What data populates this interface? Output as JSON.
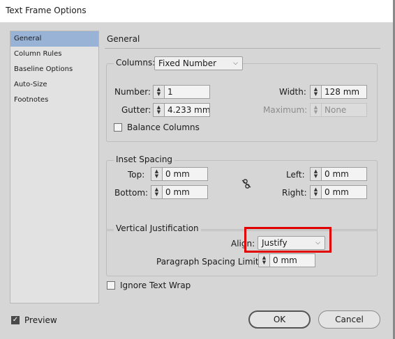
{
  "window": {
    "title": "Text Frame Options"
  },
  "sidebar": {
    "items": [
      {
        "label": "General",
        "selected": true
      },
      {
        "label": "Column Rules",
        "selected": false
      },
      {
        "label": "Baseline Options",
        "selected": false
      },
      {
        "label": "Auto-Size",
        "selected": false
      },
      {
        "label": "Footnotes",
        "selected": false
      }
    ]
  },
  "main": {
    "section_title": "General",
    "columns": {
      "label": "Columns:",
      "type_value": "Fixed Number",
      "number_label": "Number:",
      "number_value": "1",
      "gutter_label": "Gutter:",
      "gutter_value": "4.233 mm",
      "width_label": "Width:",
      "width_value": "128 mm",
      "maximum_label": "Maximum:",
      "maximum_value": "None",
      "balance_label": "Balance Columns",
      "balance_checked": false
    },
    "inset": {
      "legend": "Inset Spacing",
      "top_label": "Top:",
      "top_value": "0 mm",
      "bottom_label": "Bottom:",
      "bottom_value": "0 mm",
      "left_label": "Left:",
      "left_value": "0 mm",
      "right_label": "Right:",
      "right_value": "0 mm"
    },
    "vertical": {
      "legend": "Vertical Justification",
      "align_label": "Align:",
      "align_value": "Justify",
      "spacing_label": "Paragraph Spacing Limit:",
      "spacing_value": "0 mm"
    },
    "ignore_wrap_label": "Ignore Text Wrap",
    "ignore_wrap_checked": false
  },
  "footer": {
    "preview_label": "Preview",
    "preview_checked": true,
    "ok_label": "OK",
    "cancel_label": "Cancel"
  },
  "colors": {
    "highlight": "#e00000",
    "sidebar_selected": "#99b3d6"
  }
}
